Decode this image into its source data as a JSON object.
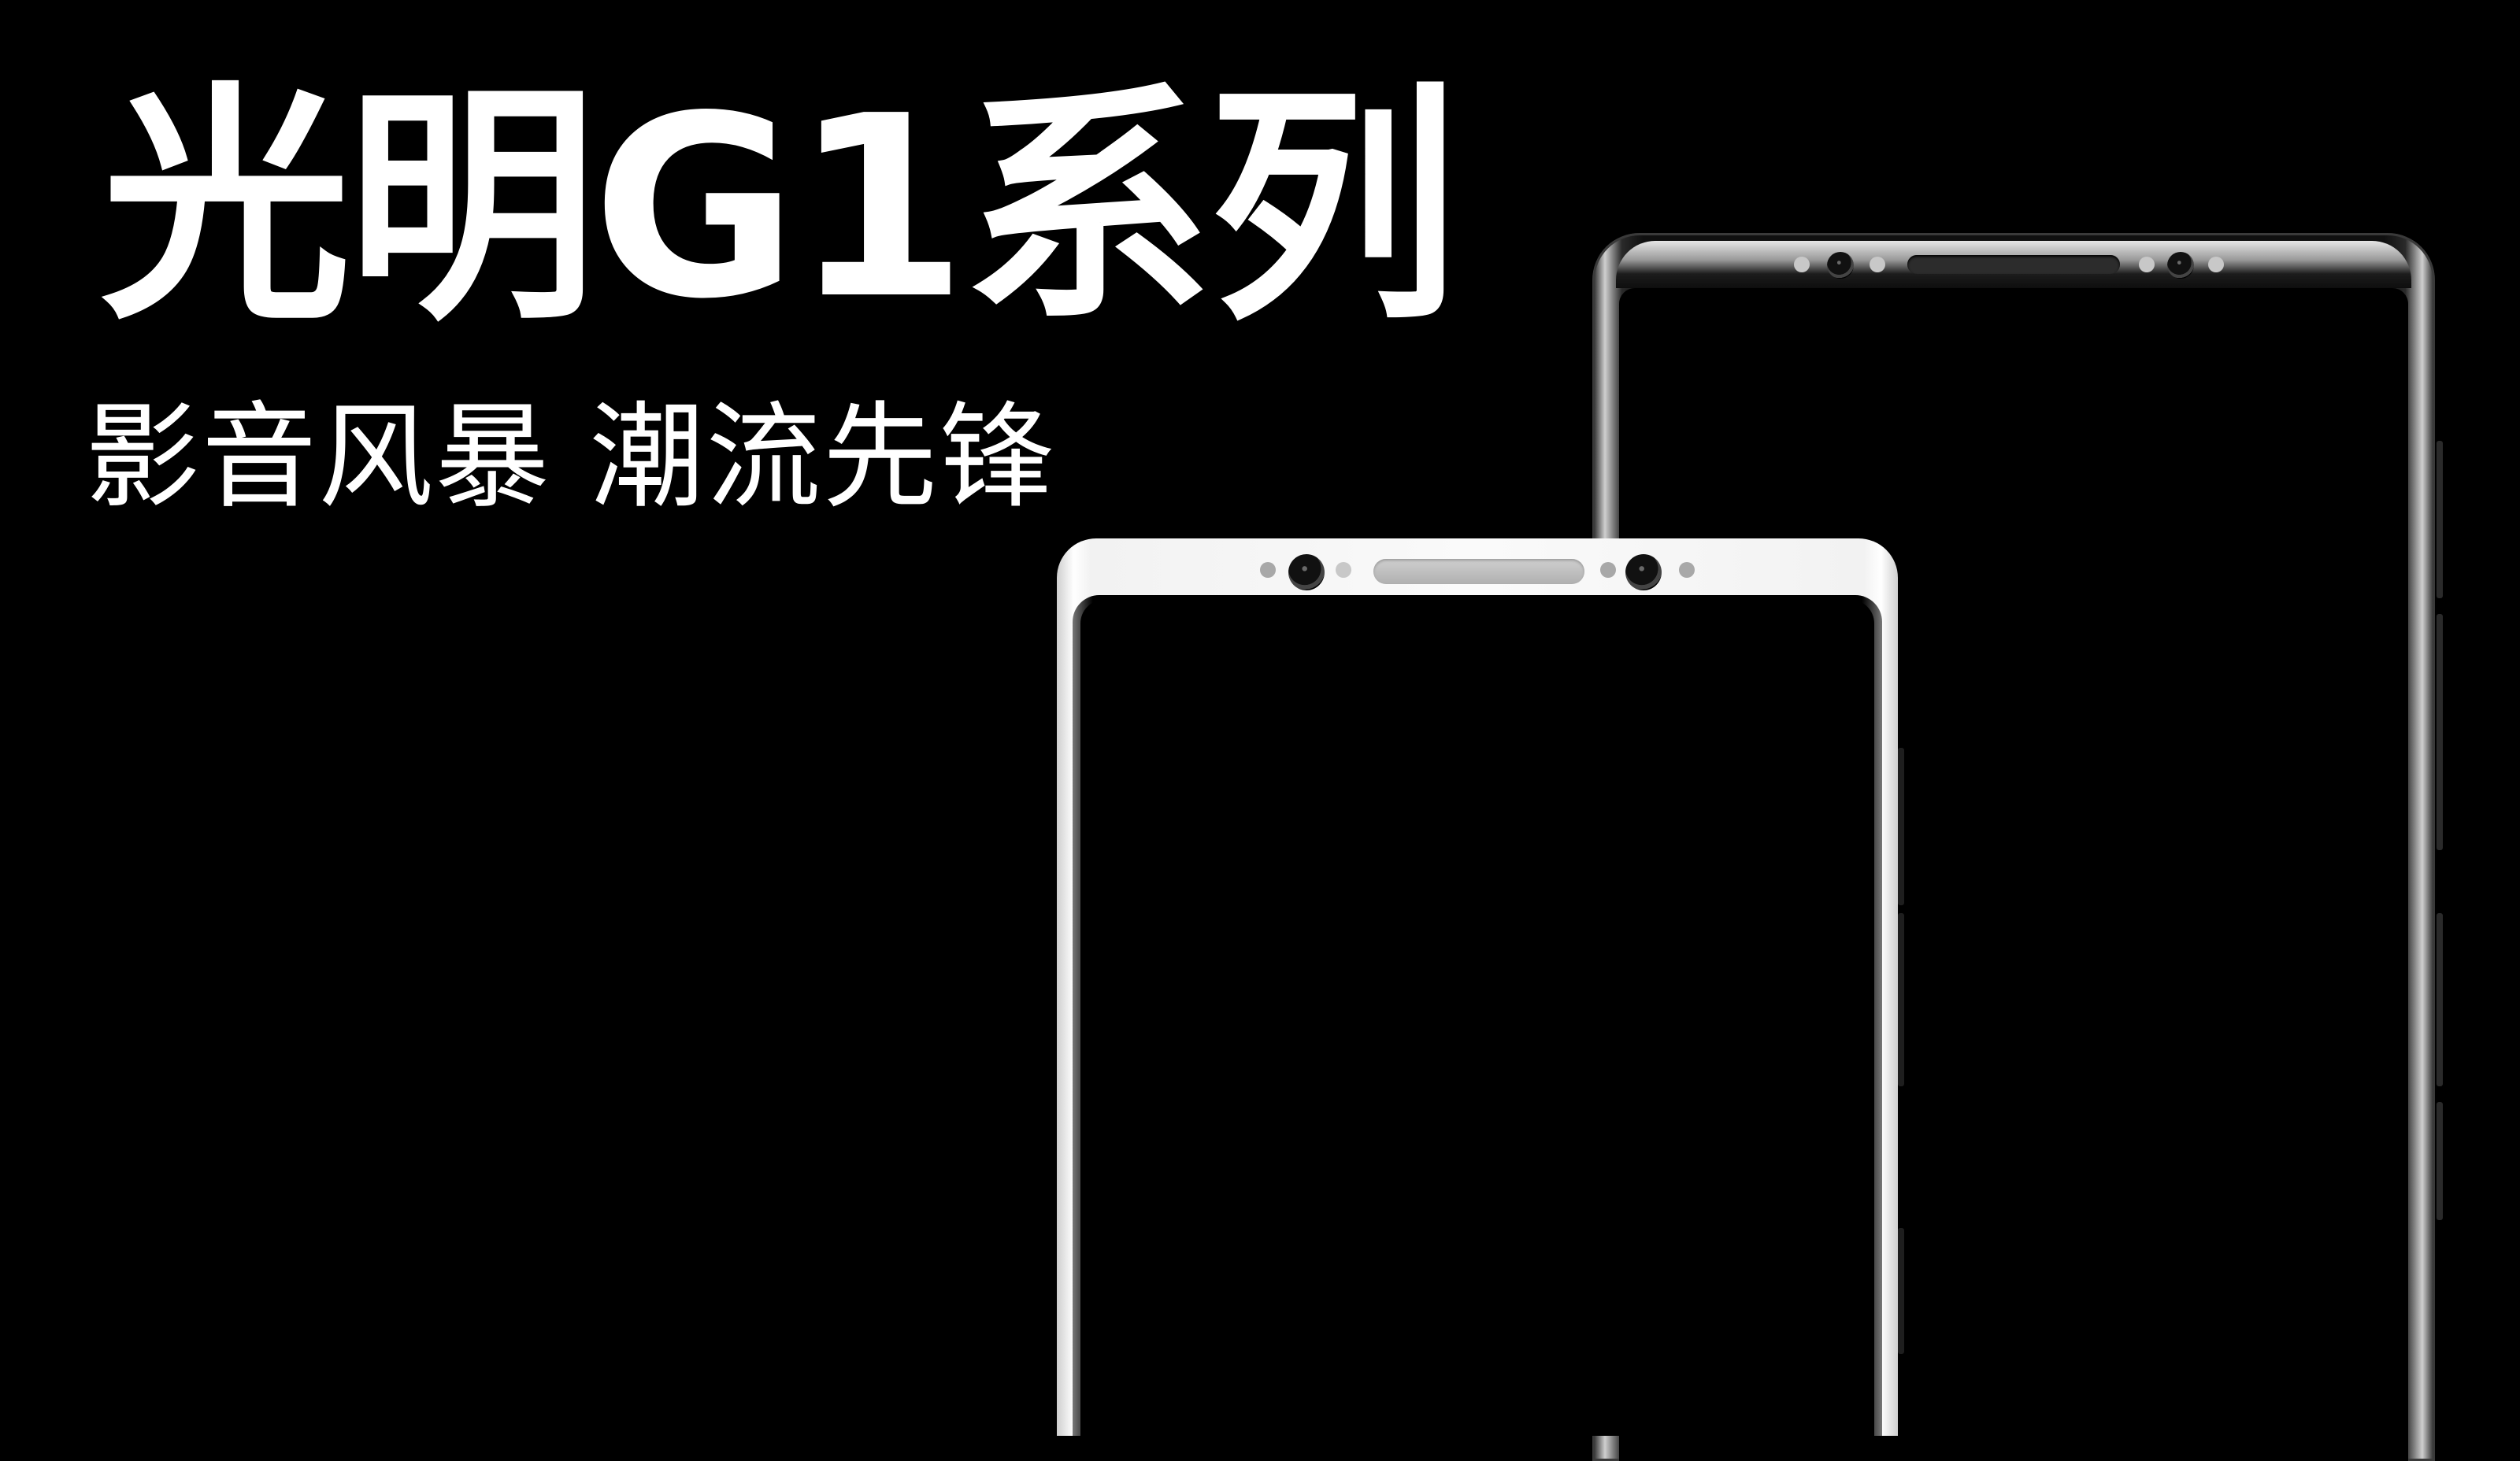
{
  "headline": "光明G1系列",
  "tagline": "影音风暴 潮流先锋",
  "colors": {
    "background": "#000000",
    "text": "#ffffff",
    "front_phone_frame": "#f5f5f5",
    "back_phone_frame": "#111111"
  },
  "phones": [
    {
      "name": "back-phone",
      "finish": "black"
    },
    {
      "name": "front-phone",
      "finish": "white"
    }
  ]
}
